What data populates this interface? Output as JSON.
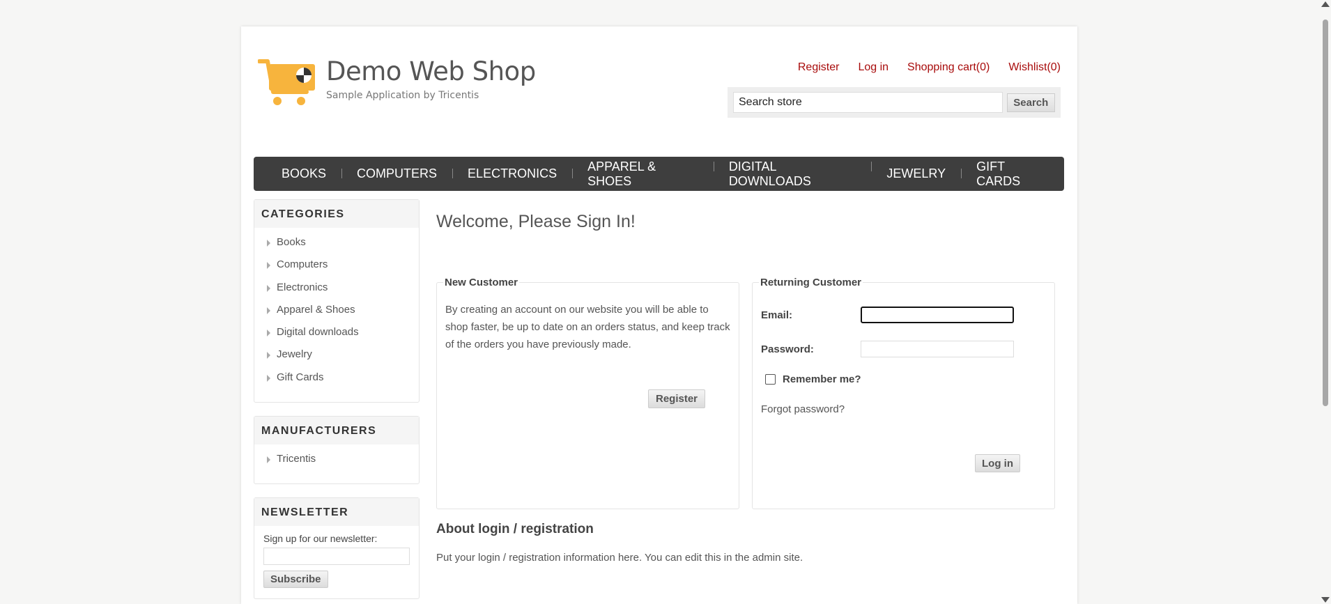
{
  "header": {
    "logo_title": "Demo Web Shop",
    "logo_subtitle": "Sample Application by Tricentis",
    "links": [
      "Register",
      "Log in",
      "Shopping cart(0)",
      "Wishlist(0)"
    ],
    "search_value": "Search store",
    "search_button": "Search"
  },
  "nav": [
    "BOOKS",
    "COMPUTERS",
    "ELECTRONICS",
    "APPAREL & SHOES",
    "DIGITAL DOWNLOADS",
    "JEWELRY",
    "GIFT CARDS"
  ],
  "sidebar": {
    "categories_title": "CATEGORIES",
    "categories": [
      "Books",
      "Computers",
      "Electronics",
      "Apparel & Shoes",
      "Digital downloads",
      "Jewelry",
      "Gift Cards"
    ],
    "manufacturers_title": "MANUFACTURERS",
    "manufacturers": [
      "Tricentis"
    ],
    "newsletter_title": "NEWSLETTER",
    "newsletter_label": "Sign up for our newsletter:",
    "subscribe_button": "Subscribe"
  },
  "main": {
    "title": "Welcome, Please Sign In!",
    "new_customer": {
      "legend": "New Customer",
      "text": "By creating an account on our website you will be able to shop faster, be up to date on an orders status, and keep track of the orders you have previously made.",
      "register_button": "Register"
    },
    "returning_customer": {
      "legend": "Returning Customer",
      "email_label": "Email:",
      "password_label": "Password:",
      "remember_label": "Remember me?",
      "forgot_link": "Forgot password?",
      "login_button": "Log in"
    },
    "about_title": "About login / registration",
    "about_text": "Put your login / registration information here. You can edit this in the admin site."
  },
  "colors": {
    "link": "#a80b0b",
    "nav_bg": "#3e3e3e",
    "logo_orange": "#f7b43d"
  }
}
